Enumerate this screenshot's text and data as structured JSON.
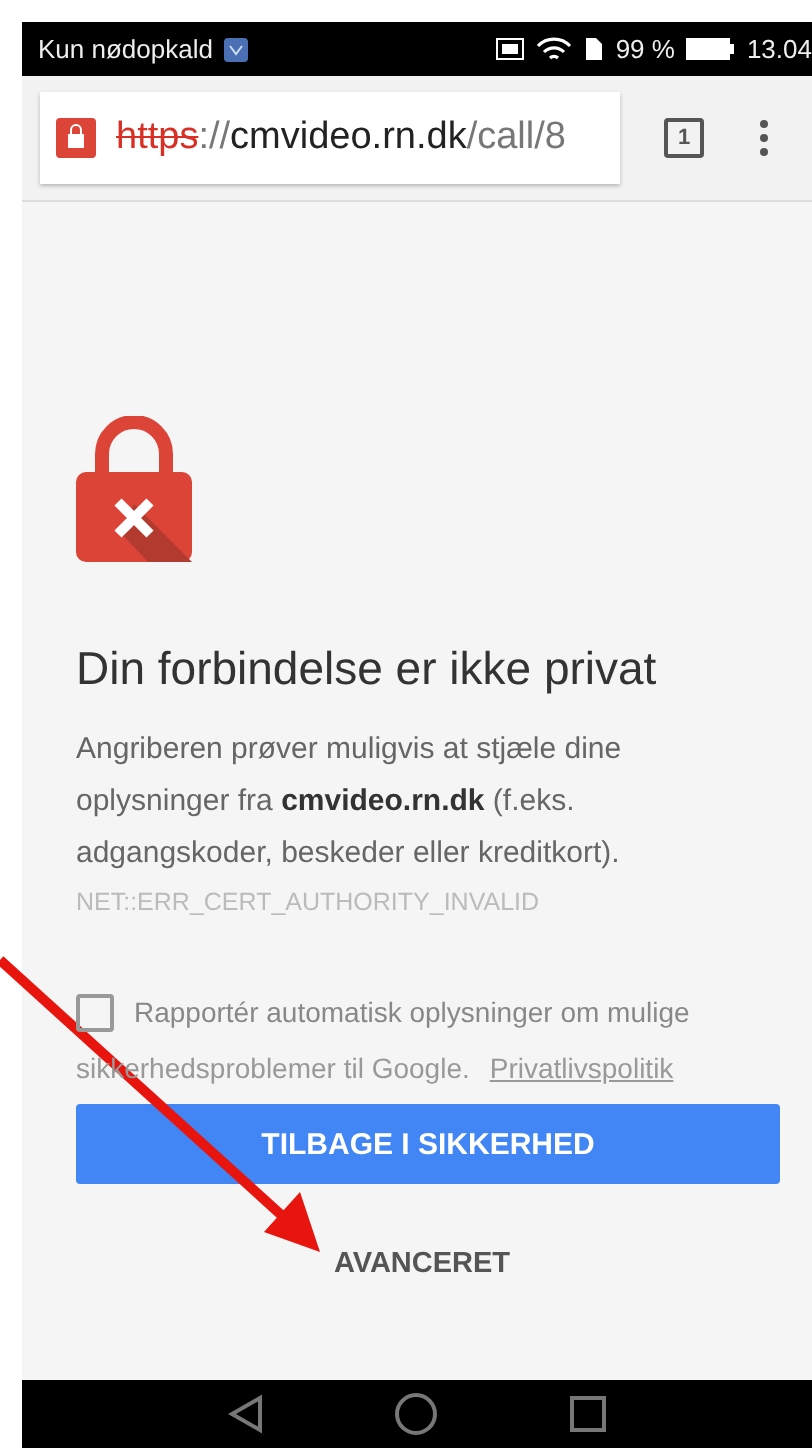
{
  "status_bar": {
    "carrier": "Kun nødopkald",
    "battery": "99 %",
    "time": "13.04"
  },
  "address_bar": {
    "scheme": "https",
    "separator": "://",
    "host": "cmvideo.rn.dk",
    "path": "/call/8",
    "insecure": true
  },
  "tab_count": "1",
  "error": {
    "title": "Din forbindelse er ikke privat",
    "body": "Angriberen prøver muligvis at stjæle dine oplysninger fra **cmvideo.rn.dk** (f.eks. adgangskoder, beskeder eller kreditkort).",
    "code": "NET::ERR_CERT_AUTHORITY_INVALID"
  },
  "report": {
    "checked": false,
    "label_lines": [
      "Rapportér automatisk oplysninger om mulige",
      "sikkerhedsproblemer til Google."
    ],
    "link": "Privatlivspolitik"
  },
  "buttons": {
    "primary": "TILBAGE I SIKKERHED",
    "advanced": "AVANCERET"
  }
}
